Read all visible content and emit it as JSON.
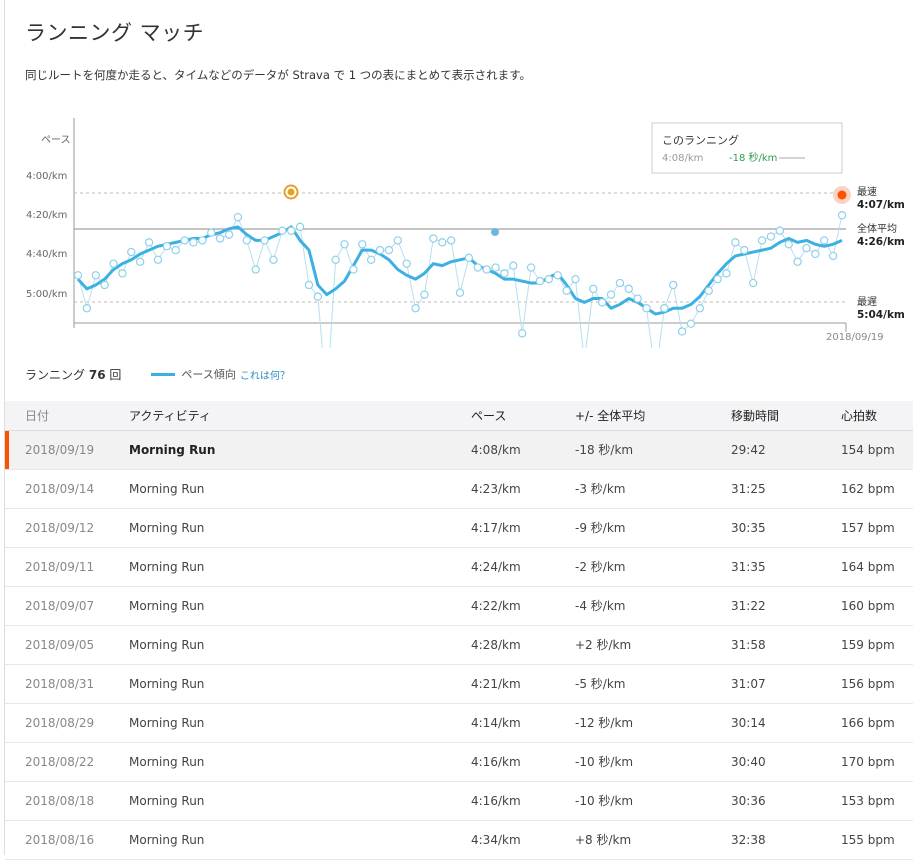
{
  "page": {
    "title": "ランニング マッチ",
    "description": "同じルートを何度か走ると、タイムなどのデータが Strava で 1 つの表にまとめて表示されます。"
  },
  "chart_data": {
    "type": "scatter",
    "ylabel": "ペース",
    "y_ticks": [
      "4:00/km",
      "4:20/km",
      "4:40/km",
      "5:00/km"
    ],
    "x_end_label": "2018/09/19",
    "y_reversed": true,
    "ylim": [
      3.96,
      5.1
    ],
    "fastest": {
      "label": "最速",
      "value": "4:07/km"
    },
    "average": {
      "label": "全体平均",
      "value": "4:26/km"
    },
    "slowest": {
      "label": "最遅",
      "value": "5:04/km"
    },
    "tooltip": {
      "title": "このランニング",
      "pace": "4:08/km",
      "diff": "-18 秒/km"
    },
    "points": [
      4.43,
      4.6,
      4.43,
      4.48,
      4.37,
      4.42,
      4.31,
      4.36,
      4.26,
      4.35,
      4.28,
      4.3,
      4.25,
      4.26,
      4.25,
      4.21,
      4.24,
      4.22,
      4.13,
      4.25,
      4.4,
      4.25,
      4.35,
      4.2,
      4.2,
      4.18,
      4.48,
      4.54,
      5.07,
      4.35,
      4.27,
      4.4,
      4.27,
      4.35,
      4.3,
      4.3,
      4.25,
      4.37,
      4.6,
      4.53,
      4.24,
      4.26,
      4.25,
      4.52,
      4.34,
      4.39,
      4.4,
      4.39,
      4.42,
      4.38,
      4.73,
      4.39,
      4.46,
      4.45,
      4.43,
      4.51,
      4.45,
      4.87,
      4.5,
      4.57,
      4.53,
      4.47,
      4.5,
      4.55,
      4.6,
      4.95,
      4.6,
      4.48,
      4.72,
      4.68,
      4.6,
      4.51,
      4.45,
      4.42,
      4.26,
      4.3,
      4.47,
      4.25,
      4.23,
      4.2,
      4.27,
      4.36,
      4.29,
      4.32,
      4.25,
      4.33,
      4.12
    ],
    "trend": [
      4.45,
      4.5,
      4.48,
      4.45,
      4.4,
      4.37,
      4.35,
      4.32,
      4.3,
      4.28,
      4.27,
      4.26,
      4.25,
      4.24,
      4.24,
      4.22,
      4.21,
      4.19,
      4.18,
      4.22,
      4.25,
      4.25,
      4.23,
      4.21,
      4.18,
      4.25,
      4.3,
      4.48,
      4.53,
      4.5,
      4.46,
      4.38,
      4.3,
      4.3,
      4.32,
      4.35,
      4.4,
      4.43,
      4.45,
      4.42,
      4.37,
      4.38,
      4.36,
      4.35,
      4.34,
      4.38,
      4.4,
      4.42,
      4.45,
      4.45,
      4.46,
      4.47,
      4.47,
      4.44,
      4.42,
      4.48,
      4.55,
      4.57,
      4.55,
      4.55,
      4.6,
      4.58,
      4.55,
      4.57,
      4.6,
      4.63,
      4.62,
      4.6,
      4.6,
      4.58,
      4.54,
      4.48,
      4.42,
      4.37,
      4.33,
      4.32,
      4.31,
      4.3,
      4.29,
      4.26,
      4.24,
      4.26,
      4.25,
      4.27,
      4.28,
      4.27,
      4.25
    ]
  },
  "summary": {
    "count_label": "ランニング",
    "count_value": "76",
    "count_suffix": "回",
    "legend_label": "ペース傾向",
    "what_link": "これは何？"
  },
  "table": {
    "headers": [
      "日付",
      "アクティビティ",
      "ペース",
      "+/- 全体平均",
      "移動時間",
      "心拍数"
    ],
    "rows": [
      {
        "date": "2018/09/19",
        "activity": "Morning Run",
        "pace": "4:08/km",
        "diff": "-18 秒/km",
        "time": "29:42",
        "hr": "154 bpm"
      },
      {
        "date": "2018/09/14",
        "activity": "Morning Run",
        "pace": "4:23/km",
        "diff": "-3 秒/km",
        "time": "31:25",
        "hr": "162 bpm"
      },
      {
        "date": "2018/09/12",
        "activity": "Morning Run",
        "pace": "4:17/km",
        "diff": "-9 秒/km",
        "time": "30:35",
        "hr": "157 bpm"
      },
      {
        "date": "2018/09/11",
        "activity": "Morning Run",
        "pace": "4:24/km",
        "diff": "-2 秒/km",
        "time": "31:35",
        "hr": "164 bpm"
      },
      {
        "date": "2018/09/07",
        "activity": "Morning Run",
        "pace": "4:22/km",
        "diff": "-4 秒/km",
        "time": "31:22",
        "hr": "160 bpm"
      },
      {
        "date": "2018/09/05",
        "activity": "Morning Run",
        "pace": "4:28/km",
        "diff": "+2 秒/km",
        "time": "31:58",
        "hr": "159 bpm"
      },
      {
        "date": "2018/08/31",
        "activity": "Morning Run",
        "pace": "4:21/km",
        "diff": "-5 秒/km",
        "time": "31:07",
        "hr": "156 bpm"
      },
      {
        "date": "2018/08/29",
        "activity": "Morning Run",
        "pace": "4:14/km",
        "diff": "-12 秒/km",
        "time": "30:14",
        "hr": "166 bpm"
      },
      {
        "date": "2018/08/22",
        "activity": "Morning Run",
        "pace": "4:16/km",
        "diff": "-10 秒/km",
        "time": "30:40",
        "hr": "170 bpm"
      },
      {
        "date": "2018/08/18",
        "activity": "Morning Run",
        "pace": "4:16/km",
        "diff": "-10 秒/km",
        "time": "30:36",
        "hr": "153 bpm"
      },
      {
        "date": "2018/08/16",
        "activity": "Morning Run",
        "pace": "4:34/km",
        "diff": "+8 秒/km",
        "time": "32:38",
        "hr": "155 bpm"
      }
    ]
  },
  "colors": {
    "accent": "#fc5200",
    "trend": "#3cb0e0",
    "point": "#8fd0ea",
    "gold": "#e8a024"
  }
}
